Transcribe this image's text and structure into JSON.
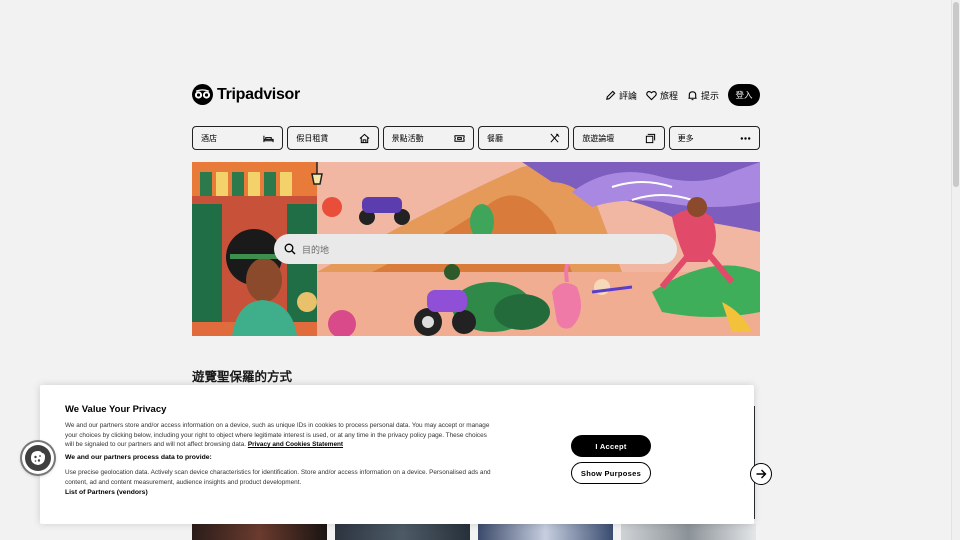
{
  "brand": {
    "name": "Tripadvisor"
  },
  "nav": {
    "reviews": "評論",
    "trips": "旅程",
    "alerts": "提示",
    "login": "登入"
  },
  "categories": [
    {
      "label": "酒店",
      "icon": "bed-icon"
    },
    {
      "label": "假日租賃",
      "icon": "house-icon"
    },
    {
      "label": "景點活動",
      "icon": "ticket-icon"
    },
    {
      "label": "餐廳",
      "icon": "cutlery-icon"
    },
    {
      "label": "旅遊論壇",
      "icon": "forum-icon"
    },
    {
      "label": "更多",
      "icon": "more-icon"
    }
  ],
  "search": {
    "placeholder": "目的地"
  },
  "section": {
    "title": "遊覽聖保羅的方式"
  },
  "cookie_banner": {
    "title": "We Value Your Privacy",
    "description": "We and our partners store and/or access information on a device, such as unique IDs in cookies to process personal data. You may accept or manage your choices by clicking below, including your right to object where legitimate interest is used, or at any time in the privacy policy page. These choices will be signaled to our partners and will not affect browsing data.",
    "statement_link": "Privacy and Cookies Statement",
    "subheading": "We and our partners process data to provide:",
    "description2": "Use precise geolocation data. Actively scan device characteristics for identification. Store and/or access information on a device. Personalised ads and content, ad and content measurement, audience insights and product development.",
    "vendors_link": "List of Partners (vendors)",
    "accept_label": "I Accept",
    "purposes_label": "Show Purposes"
  },
  "colors": {
    "brand": "#000000",
    "page_bg": "#f2f2f2",
    "search_bg": "#e9e9e9"
  }
}
